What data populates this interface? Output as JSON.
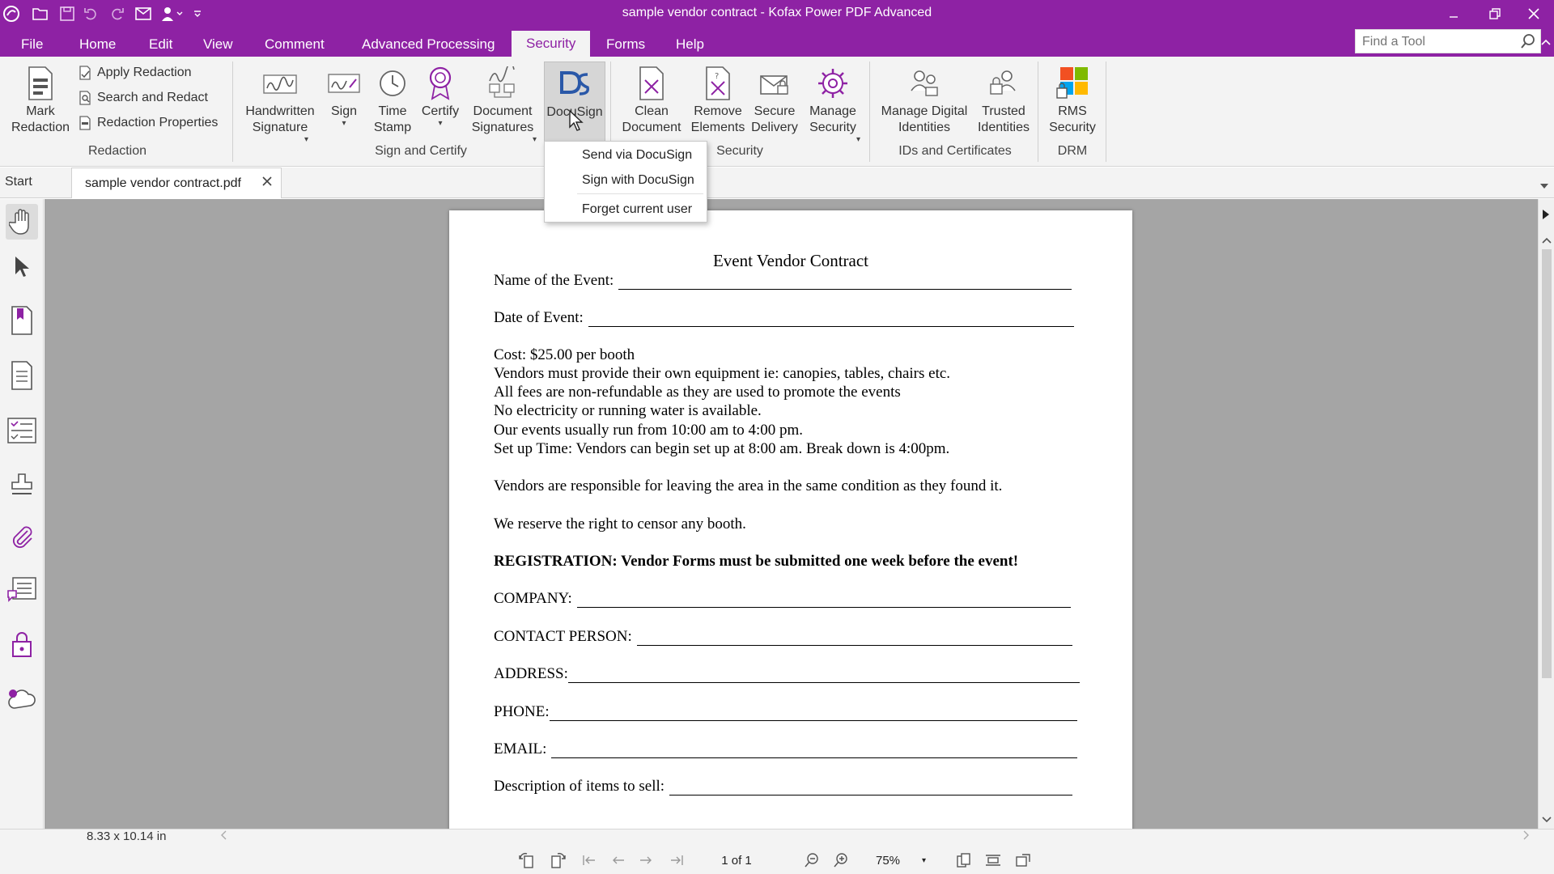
{
  "window": {
    "title": "sample vendor contract - Kofax Power PDF Advanced"
  },
  "menu": {
    "tabs": [
      "File",
      "Home",
      "Edit",
      "View",
      "Comment",
      "Advanced Processing",
      "Security",
      "Forms",
      "Help"
    ],
    "active": "Security"
  },
  "search": {
    "placeholder": "Find a Tool"
  },
  "ribbon": {
    "redaction": {
      "mark_redaction": "Mark\nRedaction",
      "apply_redaction": "Apply Redaction",
      "search_and_redact": "Search and Redact",
      "redaction_properties": "Redaction Properties",
      "group_label": "Redaction"
    },
    "sign_certify": {
      "handwritten_signature": "Handwritten\nSignature",
      "sign": "Sign",
      "time_stamp": "Time\nStamp",
      "certify": "Certify",
      "document_signatures": "Document\nSignatures",
      "docusign": "DocuSign",
      "group_label": "Sign and Certify"
    },
    "security": {
      "clean_document": "Clean\nDocument",
      "remove_elements": "Remove\nElements",
      "secure_delivery": "Secure\nDelivery",
      "manage_security": "Manage\nSecurity",
      "group_label": "Security"
    },
    "ids": {
      "manage_digital_identities": "Manage Digital\nIdentities",
      "trusted_identities": "Trusted\nIdentities",
      "group_label": "IDs and Certificates"
    },
    "drm": {
      "rms_security": "RMS\nSecurity",
      "group_label": "DRM"
    }
  },
  "docusign_menu": {
    "items": [
      "Send via DocuSign",
      "Sign with DocuSign",
      "Forget current user"
    ]
  },
  "doc_tabs": {
    "start": "Start",
    "active": "sample vendor contract.pdf"
  },
  "left_panel": {
    "icons": [
      "hand-tool-icon",
      "select-arrow-icon",
      "bookmarks-icon",
      "pages-icon",
      "forms-list-icon",
      "stamp-icon",
      "attachment-icon",
      "comments-icon",
      "lock-icon",
      "cloud-icon"
    ]
  },
  "document": {
    "title": "Event Vendor Contract",
    "name_of_event": "Name of the Event:",
    "date_of_event": "Date of Event:",
    "cost": "Cost:  $25.00   per booth",
    "rules": [
      "Vendors must provide their own equipment ie:  canopies, tables, chairs etc.",
      "All fees are non-refundable as they are used to promote the events",
      "No electricity or running water is available.",
      "Our events usually run from 10:00 am to 4:00 pm.",
      "Set up Time: Vendors can begin set up at 8:00 am.  Break down is 4:00pm."
    ],
    "responsibility": "Vendors are responsible for leaving the area in the same condition as they found it.",
    "censor": "We reserve the right to censor any booth.",
    "registration": "REGISTRATION:    Vendor Forms must be submitted one week before the event!",
    "fields": [
      "COMPANY:",
      "CONTACT PERSON:",
      "ADDRESS:",
      "PHONE:",
      "EMAIL:",
      "Description of items to sell:"
    ]
  },
  "status": {
    "dimensions": "8.33 x 10.14 in",
    "page": "1 of 1",
    "zoom": "75%"
  },
  "colors": {
    "brand": "#8e22a4",
    "ribbon": "#f3f3f3",
    "viewer": "#a5a5a5"
  }
}
